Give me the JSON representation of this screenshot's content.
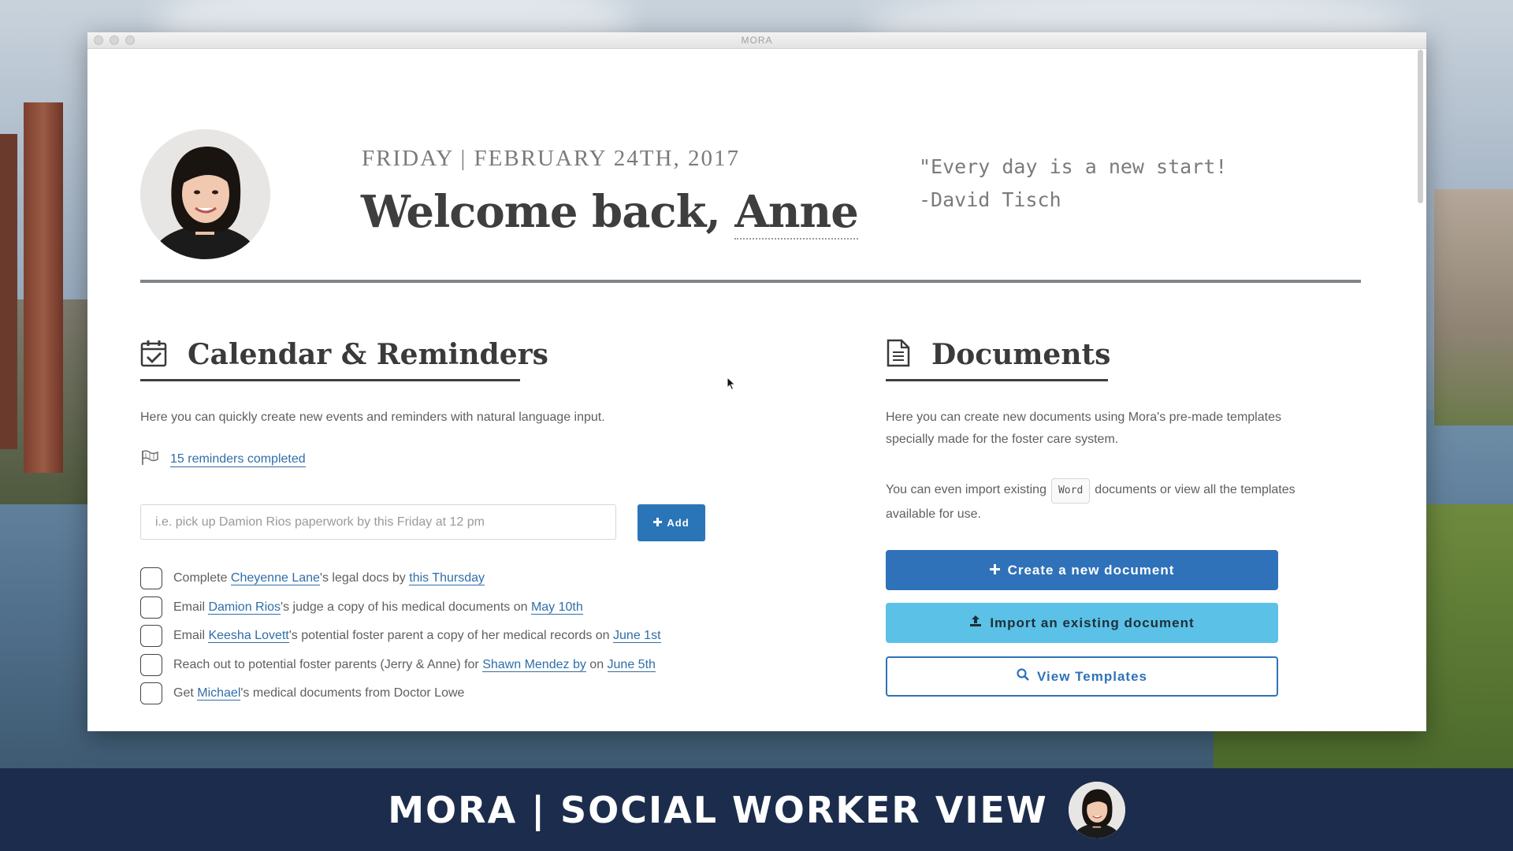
{
  "window": {
    "title": "MORA"
  },
  "header": {
    "date": "FRIDAY | FEBRUARY 24TH, 2017",
    "welcome_prefix": "Welcome back, ",
    "user_name": "Anne",
    "quote_line1": "\"Every day is a new start!",
    "quote_line2": "-David Tisch"
  },
  "calendar": {
    "heading": "Calendar & Reminders",
    "description": "Here you can quickly create new events and reminders with natural language input.",
    "reminders_completed": "15 reminders completed",
    "input_placeholder": "i.e. pick up Damion Rios paperwork by this Friday at 12 pm",
    "add_label": "Add",
    "todos": [
      {
        "parts": [
          {
            "t": "Complete "
          },
          {
            "t": "Cheyenne Lane",
            "link": true
          },
          {
            "t": "'s legal docs by "
          },
          {
            "t": "this Thursday",
            "link": true
          }
        ]
      },
      {
        "parts": [
          {
            "t": "Email "
          },
          {
            "t": "Damion Rios",
            "link": true
          },
          {
            "t": "'s judge a copy of his medical documents on "
          },
          {
            "t": "May 10th",
            "link": true
          }
        ]
      },
      {
        "parts": [
          {
            "t": "Email "
          },
          {
            "t": "Keesha Lovett",
            "link": true
          },
          {
            "t": "'s potential foster parent a copy of her medical records on "
          },
          {
            "t": "June 1st",
            "link": true
          }
        ]
      },
      {
        "parts": [
          {
            "t": "Reach out to potential foster parents (Jerry & Anne) for "
          },
          {
            "t": "Shawn Mendez by",
            "link": true
          },
          {
            "t": " on "
          },
          {
            "t": "June 5th",
            "link": true
          }
        ]
      },
      {
        "parts": [
          {
            "t": "Get "
          },
          {
            "t": "Michael",
            "link": true
          },
          {
            "t": "'s medical documents from Doctor Lowe"
          }
        ]
      }
    ]
  },
  "documents": {
    "heading": "Documents",
    "description": "Here you can create new documents using Mora's pre-made templates specially made for the foster care system.",
    "import_text_before": "You can even import existing",
    "import_chip": "Word",
    "import_text_after": "documents or view all the templates available for use.",
    "create_label": "Create a new document",
    "import_label": "Import an existing document",
    "view_label": "View Templates"
  },
  "footer": {
    "title": "MORA | SOCIAL WORKER VIEW"
  },
  "colors": {
    "primary": "#2f72b9",
    "info": "#5bc1e7",
    "link": "#2f6ea8",
    "footer_bg": "#1c2c4c"
  }
}
